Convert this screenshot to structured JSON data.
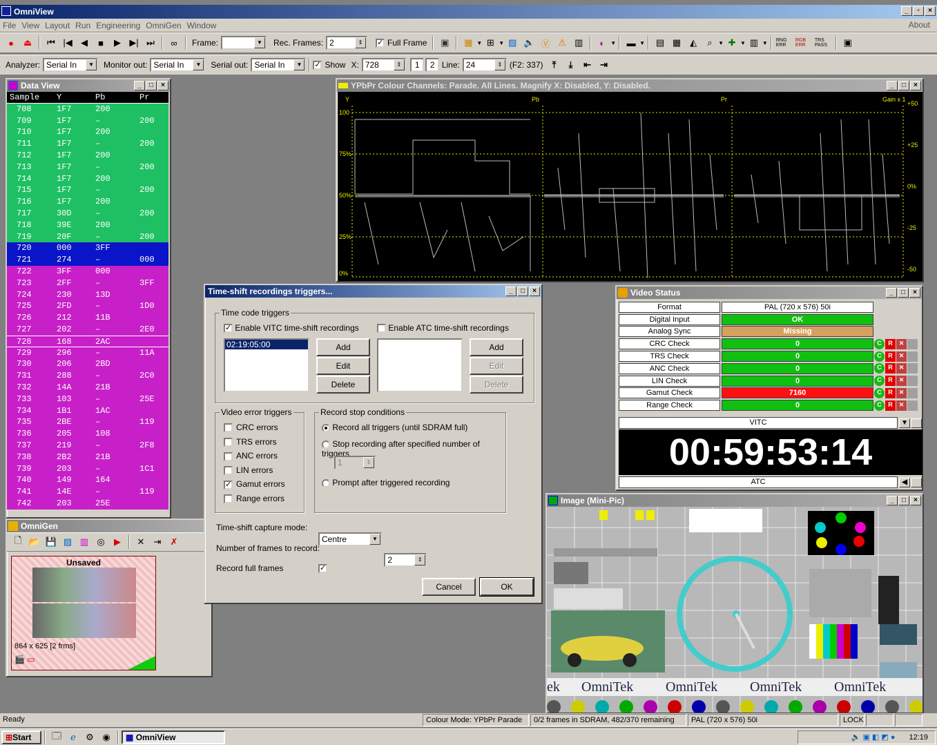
{
  "app": {
    "title": "OmniView",
    "menu": [
      "File",
      "View",
      "Layout",
      "Run",
      "Engineering",
      "OmniGen",
      "Window"
    ],
    "about": "About"
  },
  "toolbar1": {
    "frame_label": "Frame:",
    "frame_value": "",
    "rec_frames_label": "Rec. Frames:",
    "rec_frames_value": "2",
    "full_frame_label": "Full Frame"
  },
  "toolbar2": {
    "analyzer_label": "Analyzer:",
    "analyzer_value": "Serial In",
    "monitor_label": "Monitor out:",
    "monitor_value": "Serial In",
    "serial_label": "Serial out:",
    "serial_value": "Serial In",
    "show_label": "Show",
    "x_label": "X:",
    "x_value": "728",
    "field1": "1",
    "field2": "2",
    "line_label": "Line:",
    "line_value": "24",
    "f2_text": "(F2: 337)"
  },
  "dataview": {
    "title": "Data View",
    "headers": [
      "Sample",
      "Y",
      "Pb",
      "Pr"
    ],
    "rows": [
      [
        "708",
        "1F7",
        "200",
        "",
        "#1fc064"
      ],
      [
        "709",
        "1F7",
        "–",
        "200",
        "#1fc064"
      ],
      [
        "710",
        "1F7",
        "200",
        "",
        "#1fc064"
      ],
      [
        "711",
        "1F7",
        "–",
        "200",
        "#1fc064"
      ],
      [
        "712",
        "1F7",
        "200",
        "",
        "#1fc064"
      ],
      [
        "713",
        "1F7",
        "–",
        "200",
        "#1fc064"
      ],
      [
        "714",
        "1F7",
        "200",
        "",
        "#1fc064"
      ],
      [
        "715",
        "1F7",
        "–",
        "200",
        "#1fc064"
      ],
      [
        "716",
        "1F7",
        "200",
        "",
        "#1fc064"
      ],
      [
        "717",
        "30D",
        "–",
        "200",
        "#1fc064"
      ],
      [
        "718",
        "39E",
        "200",
        "",
        "#1fc064"
      ],
      [
        "719",
        "20F",
        "–",
        "200",
        "#1fc064"
      ],
      [
        "720",
        "000",
        "3FF",
        "",
        "#0a14c8"
      ],
      [
        "721",
        "274",
        "–",
        "000",
        "#0a14c8"
      ],
      [
        "722",
        "3FF",
        "000",
        "",
        "#c820c8"
      ],
      [
        "723",
        "2FF",
        "–",
        "3FF",
        "#c820c8"
      ],
      [
        "724",
        "230",
        "13D",
        "",
        "#c820c8"
      ],
      [
        "725",
        "2FD",
        "–",
        "1D0",
        "#c820c8"
      ],
      [
        "726",
        "212",
        "11B",
        "",
        "#c820c8"
      ],
      [
        "727",
        "202",
        "–",
        "2E0",
        "#c820c8"
      ],
      [
        "728",
        "168",
        "2AC",
        "",
        "#c820c8"
      ],
      [
        "729",
        "296",
        "–",
        "11A",
        "#c820c8"
      ],
      [
        "730",
        "206",
        "2BD",
        "",
        "#c820c8"
      ],
      [
        "731",
        "288",
        "–",
        "2C0",
        "#c820c8"
      ],
      [
        "732",
        "14A",
        "21B",
        "",
        "#c820c8"
      ],
      [
        "733",
        "103",
        "–",
        "25E",
        "#c820c8"
      ],
      [
        "734",
        "1B1",
        "1AC",
        "",
        "#c820c8"
      ],
      [
        "735",
        "2BE",
        "–",
        "119",
        "#c820c8"
      ],
      [
        "736",
        "205",
        "108",
        "",
        "#c820c8"
      ],
      [
        "737",
        "219",
        "–",
        "2F8",
        "#c820c8"
      ],
      [
        "738",
        "2B2",
        "21B",
        "",
        "#c820c8"
      ],
      [
        "739",
        "203",
        "–",
        "1C1",
        "#c820c8"
      ],
      [
        "740",
        "149",
        "164",
        "",
        "#c820c8"
      ],
      [
        "741",
        "14E",
        "–",
        "119",
        "#c820c8"
      ],
      [
        "742",
        "203",
        "25E",
        "",
        "#c820c8"
      ]
    ]
  },
  "parade": {
    "title": "YPbPr Colour Channels: Parade. All Lines. Magnify X: Disabled, Y: Disabled.",
    "ch_y": "Y",
    "ch_pb": "Pb",
    "ch_pr": "Pr",
    "gain": "Gain x 1",
    "left_ticks": [
      "100",
      "75%",
      "50%",
      "25%",
      "0%"
    ],
    "right_ticks": [
      "+50",
      "+25",
      "0%",
      "-25",
      "-50"
    ]
  },
  "dialog": {
    "title": "Time-shift recordings triggers...",
    "tc_group": "Time code triggers",
    "vitc_label": "Enable VITC time-shift recordings",
    "atc_label": "Enable ATC time-shift recordings",
    "vitc_items": [
      "02:19:05:00"
    ],
    "add": "Add",
    "edit": "Edit",
    "delete": "Delete",
    "video_group": "Video error triggers",
    "errors": [
      {
        "label": "CRC errors",
        "checked": false
      },
      {
        "label": "TRS errors",
        "checked": false
      },
      {
        "label": "ANC errors",
        "checked": false
      },
      {
        "label": "LIN errors",
        "checked": false
      },
      {
        "label": "Gamut errors",
        "checked": true
      },
      {
        "label": "Range errors",
        "checked": false
      }
    ],
    "stop_group": "Record stop conditions",
    "stop_opt1": "Record all triggers (until SDRAM full)",
    "stop_opt2": "Stop recording after specified number of triggers",
    "stop_count": "1",
    "stop_opt3": "Prompt after triggered recording",
    "capture_label": "Time-shift capture mode:",
    "capture_value": "Centre",
    "frames_label": "Number of frames to record:",
    "frames_value": "2",
    "full_label": "Record full frames",
    "cancel": "Cancel",
    "ok": "OK"
  },
  "videostatus": {
    "title": "Video Status",
    "rows": [
      {
        "name": "Format",
        "value": "PAL (720 x 576) 50i",
        "color": "#ffffff",
        "text": "#000000",
        "btns": false
      },
      {
        "name": "Digital Input",
        "value": "OK",
        "color": "#10c010",
        "text": "#ffffff",
        "btns": false
      },
      {
        "name": "Analog Sync",
        "value": "Missing",
        "color": "#d8a060",
        "text": "#ffffff",
        "btns": false
      },
      {
        "name": "CRC Check",
        "value": "0",
        "color": "#10c010",
        "text": "#ffffff",
        "btns": true
      },
      {
        "name": "TRS Check",
        "value": "0",
        "color": "#10c010",
        "text": "#ffffff",
        "btns": true
      },
      {
        "name": "ANC Check",
        "value": "0",
        "color": "#10c010",
        "text": "#ffffff",
        "btns": true
      },
      {
        "name": "LIN Check",
        "value": "0",
        "color": "#10c010",
        "text": "#ffffff",
        "btns": true
      },
      {
        "name": "Gamut Check",
        "value": "7160",
        "color": "#ff1010",
        "text": "#ffffff",
        "btns": true
      },
      {
        "name": "Range Check",
        "value": "0",
        "color": "#10c010",
        "text": "#ffffff",
        "btns": true
      }
    ],
    "vitc": "VITC",
    "timecode": "00:59:53:14",
    "atc": "ATC"
  },
  "omnigen": {
    "title": "OmniGen",
    "unsaved": "Unsaved",
    "size": "864 x 625 [2 frms]"
  },
  "image": {
    "title": "Image (Mini-Pic)",
    "brand": "OmniTek",
    "prefix": "ek"
  },
  "status": {
    "ready": "Ready",
    "colour_mode": "Colour Mode: YPbPr Parade",
    "frames": "0/2 frames in SDRAM, 482/370 remaining",
    "format": "PAL (720 x 576) 50i",
    "lock": "LOCK"
  },
  "taskbar": {
    "start": "Start",
    "task": "OmniView",
    "clock": "12:19"
  }
}
